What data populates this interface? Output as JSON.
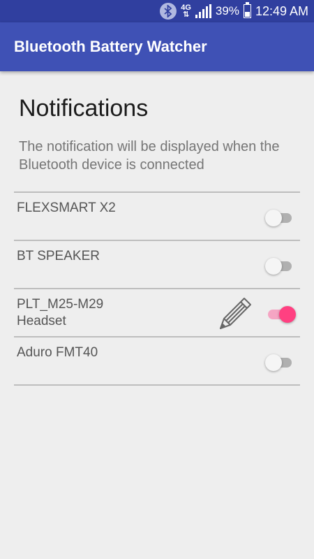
{
  "status_bar": {
    "network": "4G",
    "battery_percent": "39%",
    "time": "12:49 AM",
    "icons": [
      "bluetooth-icon",
      "network-4g-icon",
      "signal-icon",
      "battery-icon"
    ]
  },
  "app_bar": {
    "title": "Bluetooth Battery Watcher"
  },
  "main": {
    "heading": "Notifications",
    "description": "The notification will be displayed when the Bluetooth device is connected"
  },
  "devices": [
    {
      "name": "FLEXSMART X2",
      "enabled": false
    },
    {
      "name": "BT SPEAKER",
      "enabled": false
    },
    {
      "name": "PLT_M25-M29 Headset",
      "enabled": true,
      "edit_icon": "pencil-icon"
    },
    {
      "name": "Aduro FMT40",
      "enabled": false
    }
  ],
  "colors": {
    "status_bar": "#303f9f",
    "app_bar": "#3f51b5",
    "accent": "#ff4081",
    "background": "#eeeeee"
  }
}
